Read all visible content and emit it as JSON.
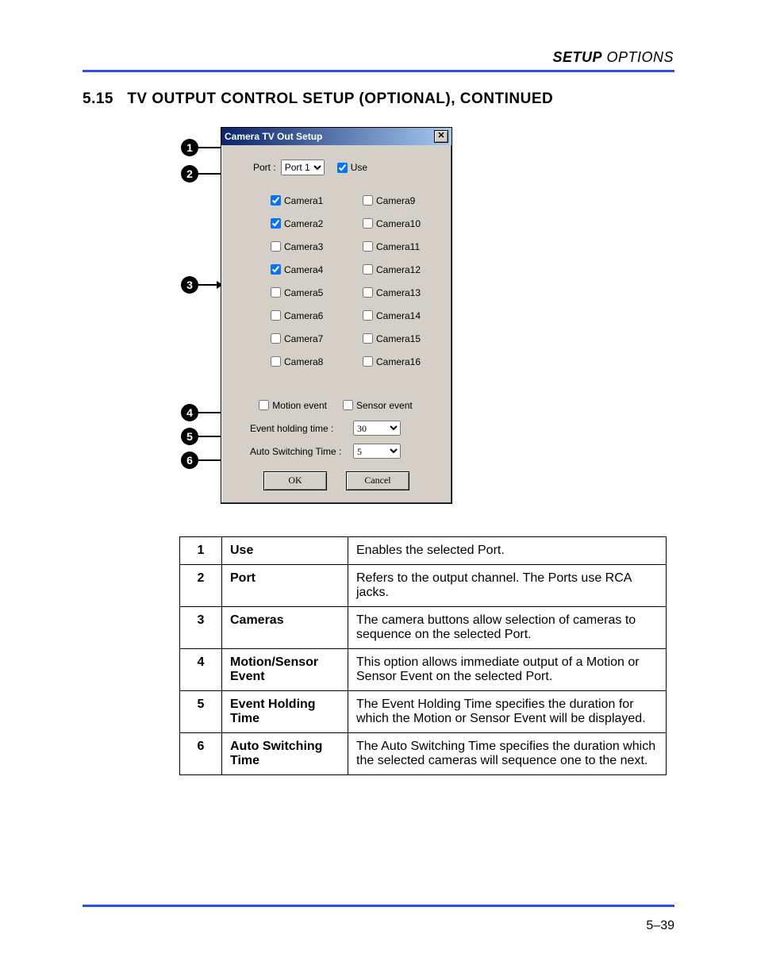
{
  "header": {
    "bold": "SETUP",
    "italic": " OPTIONS"
  },
  "section": {
    "num": "5.15",
    "title": "TV OUTPUT CONTROL SETUP (OPTIONAL), CONTINUED"
  },
  "page_number": "5–39",
  "dialog": {
    "title": "Camera TV Out Setup",
    "close": "✕",
    "port_label": "Port :",
    "port_value": "Port 1",
    "use_label": "Use",
    "use_checked": true,
    "cameras_left": [
      {
        "label": "Camera1",
        "checked": true
      },
      {
        "label": "Camera2",
        "checked": true
      },
      {
        "label": "Camera3",
        "checked": false
      },
      {
        "label": "Camera4",
        "checked": true
      },
      {
        "label": "Camera5",
        "checked": false
      },
      {
        "label": "Camera6",
        "checked": false
      },
      {
        "label": "Camera7",
        "checked": false
      },
      {
        "label": "Camera8",
        "checked": false
      }
    ],
    "cameras_right": [
      {
        "label": "Camera9",
        "checked": false
      },
      {
        "label": "Camera10",
        "checked": false
      },
      {
        "label": "Camera11",
        "checked": false
      },
      {
        "label": "Camera12",
        "checked": false
      },
      {
        "label": "Camera13",
        "checked": false
      },
      {
        "label": "Camera14",
        "checked": false
      },
      {
        "label": "Camera15",
        "checked": false
      },
      {
        "label": "Camera16",
        "checked": false
      }
    ],
    "motion_label": "Motion event",
    "motion_checked": false,
    "sensor_label": "Sensor event",
    "sensor_checked": false,
    "eht_label": "Event holding time :",
    "eht_value": "30",
    "ast_label": "Auto Switching Time :",
    "ast_value": "5",
    "ok": "OK",
    "cancel": "Cancel"
  },
  "callouts": [
    "1",
    "2",
    "3",
    "4",
    "5",
    "6"
  ],
  "table": [
    {
      "n": "1",
      "name": "Use",
      "desc": "Enables the selected Port."
    },
    {
      "n": "2",
      "name": "Port",
      "desc": "Refers to the output channel. The Ports use RCA jacks."
    },
    {
      "n": "3",
      "name": "Cameras",
      "desc": "The camera buttons allow selection of cameras to sequence on the selected Port."
    },
    {
      "n": "4",
      "name": "Motion/Sensor Event",
      "desc": "This option allows immediate output of a Motion or Sensor Event on the selected Port."
    },
    {
      "n": "5",
      "name": "Event Holding Time",
      "desc": "The Event Holding Time specifies the duration for which the Motion or Sensor Event will be displayed."
    },
    {
      "n": "6",
      "name": "Auto Switching Time",
      "desc": "The Auto Switching Time specifies the duration which the selected cameras will sequence one to the next."
    }
  ]
}
